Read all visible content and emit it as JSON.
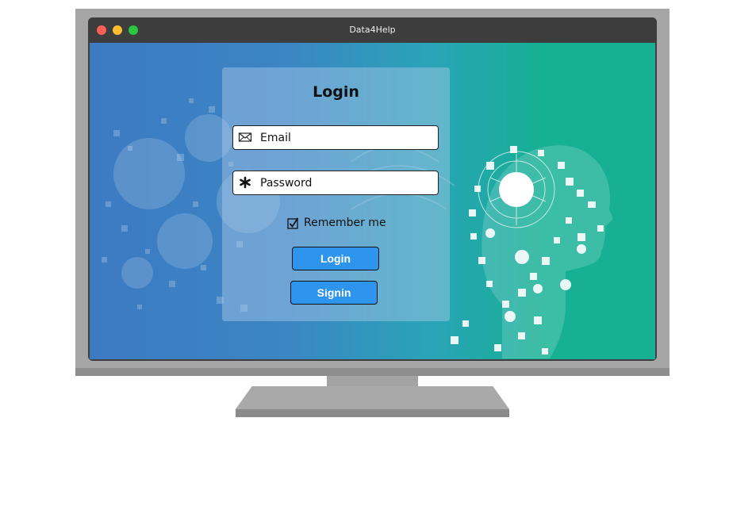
{
  "window": {
    "title": "Data4Help"
  },
  "login_form": {
    "title": "Login",
    "email_placeholder": "Email",
    "password_placeholder": "Password",
    "remember_label": "Remember me",
    "remember_checked": true,
    "login_button": "Login",
    "signin_button": "Signin"
  },
  "icons": {
    "email": "envelope-icon",
    "password": "asterisk-icon",
    "remember": "checkbox-checked-icon"
  },
  "colors": {
    "button": "#2e95ee",
    "bg_left": "#3d7ac2",
    "bg_right": "#18b094",
    "titlebar": "#3d3d3d"
  }
}
